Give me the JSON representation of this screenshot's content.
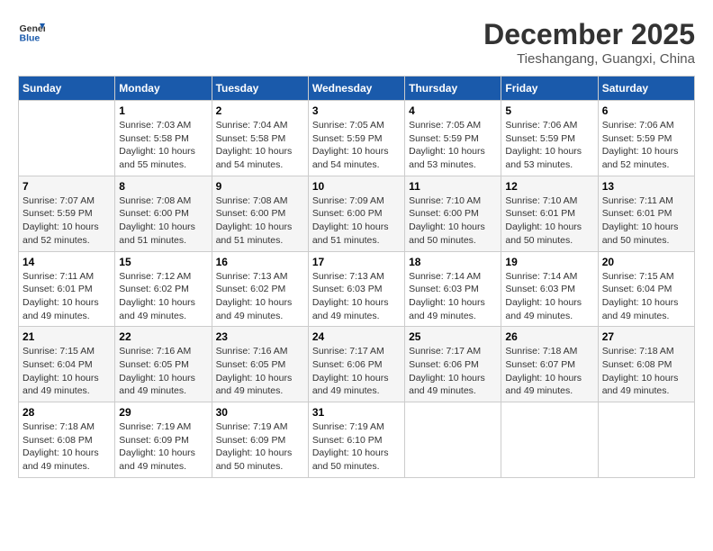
{
  "header": {
    "logo_line1": "General",
    "logo_line2": "Blue",
    "month_year": "December 2025",
    "location": "Tieshangang, Guangxi, China"
  },
  "days_of_week": [
    "Sunday",
    "Monday",
    "Tuesday",
    "Wednesday",
    "Thursday",
    "Friday",
    "Saturday"
  ],
  "weeks": [
    [
      {
        "day": "",
        "info": ""
      },
      {
        "day": "1",
        "info": "Sunrise: 7:03 AM\nSunset: 5:58 PM\nDaylight: 10 hours\nand 55 minutes."
      },
      {
        "day": "2",
        "info": "Sunrise: 7:04 AM\nSunset: 5:58 PM\nDaylight: 10 hours\nand 54 minutes."
      },
      {
        "day": "3",
        "info": "Sunrise: 7:05 AM\nSunset: 5:59 PM\nDaylight: 10 hours\nand 54 minutes."
      },
      {
        "day": "4",
        "info": "Sunrise: 7:05 AM\nSunset: 5:59 PM\nDaylight: 10 hours\nand 53 minutes."
      },
      {
        "day": "5",
        "info": "Sunrise: 7:06 AM\nSunset: 5:59 PM\nDaylight: 10 hours\nand 53 minutes."
      },
      {
        "day": "6",
        "info": "Sunrise: 7:06 AM\nSunset: 5:59 PM\nDaylight: 10 hours\nand 52 minutes."
      }
    ],
    [
      {
        "day": "7",
        "info": "Sunrise: 7:07 AM\nSunset: 5:59 PM\nDaylight: 10 hours\nand 52 minutes."
      },
      {
        "day": "8",
        "info": "Sunrise: 7:08 AM\nSunset: 6:00 PM\nDaylight: 10 hours\nand 51 minutes."
      },
      {
        "day": "9",
        "info": "Sunrise: 7:08 AM\nSunset: 6:00 PM\nDaylight: 10 hours\nand 51 minutes."
      },
      {
        "day": "10",
        "info": "Sunrise: 7:09 AM\nSunset: 6:00 PM\nDaylight: 10 hours\nand 51 minutes."
      },
      {
        "day": "11",
        "info": "Sunrise: 7:10 AM\nSunset: 6:00 PM\nDaylight: 10 hours\nand 50 minutes."
      },
      {
        "day": "12",
        "info": "Sunrise: 7:10 AM\nSunset: 6:01 PM\nDaylight: 10 hours\nand 50 minutes."
      },
      {
        "day": "13",
        "info": "Sunrise: 7:11 AM\nSunset: 6:01 PM\nDaylight: 10 hours\nand 50 minutes."
      }
    ],
    [
      {
        "day": "14",
        "info": "Sunrise: 7:11 AM\nSunset: 6:01 PM\nDaylight: 10 hours\nand 49 minutes."
      },
      {
        "day": "15",
        "info": "Sunrise: 7:12 AM\nSunset: 6:02 PM\nDaylight: 10 hours\nand 49 minutes."
      },
      {
        "day": "16",
        "info": "Sunrise: 7:13 AM\nSunset: 6:02 PM\nDaylight: 10 hours\nand 49 minutes."
      },
      {
        "day": "17",
        "info": "Sunrise: 7:13 AM\nSunset: 6:03 PM\nDaylight: 10 hours\nand 49 minutes."
      },
      {
        "day": "18",
        "info": "Sunrise: 7:14 AM\nSunset: 6:03 PM\nDaylight: 10 hours\nand 49 minutes."
      },
      {
        "day": "19",
        "info": "Sunrise: 7:14 AM\nSunset: 6:03 PM\nDaylight: 10 hours\nand 49 minutes."
      },
      {
        "day": "20",
        "info": "Sunrise: 7:15 AM\nSunset: 6:04 PM\nDaylight: 10 hours\nand 49 minutes."
      }
    ],
    [
      {
        "day": "21",
        "info": "Sunrise: 7:15 AM\nSunset: 6:04 PM\nDaylight: 10 hours\nand 49 minutes."
      },
      {
        "day": "22",
        "info": "Sunrise: 7:16 AM\nSunset: 6:05 PM\nDaylight: 10 hours\nand 49 minutes."
      },
      {
        "day": "23",
        "info": "Sunrise: 7:16 AM\nSunset: 6:05 PM\nDaylight: 10 hours\nand 49 minutes."
      },
      {
        "day": "24",
        "info": "Sunrise: 7:17 AM\nSunset: 6:06 PM\nDaylight: 10 hours\nand 49 minutes."
      },
      {
        "day": "25",
        "info": "Sunrise: 7:17 AM\nSunset: 6:06 PM\nDaylight: 10 hours\nand 49 minutes."
      },
      {
        "day": "26",
        "info": "Sunrise: 7:18 AM\nSunset: 6:07 PM\nDaylight: 10 hours\nand 49 minutes."
      },
      {
        "day": "27",
        "info": "Sunrise: 7:18 AM\nSunset: 6:08 PM\nDaylight: 10 hours\nand 49 minutes."
      }
    ],
    [
      {
        "day": "28",
        "info": "Sunrise: 7:18 AM\nSunset: 6:08 PM\nDaylight: 10 hours\nand 49 minutes."
      },
      {
        "day": "29",
        "info": "Sunrise: 7:19 AM\nSunset: 6:09 PM\nDaylight: 10 hours\nand 49 minutes."
      },
      {
        "day": "30",
        "info": "Sunrise: 7:19 AM\nSunset: 6:09 PM\nDaylight: 10 hours\nand 50 minutes."
      },
      {
        "day": "31",
        "info": "Sunrise: 7:19 AM\nSunset: 6:10 PM\nDaylight: 10 hours\nand 50 minutes."
      },
      {
        "day": "",
        "info": ""
      },
      {
        "day": "",
        "info": ""
      },
      {
        "day": "",
        "info": ""
      }
    ]
  ]
}
